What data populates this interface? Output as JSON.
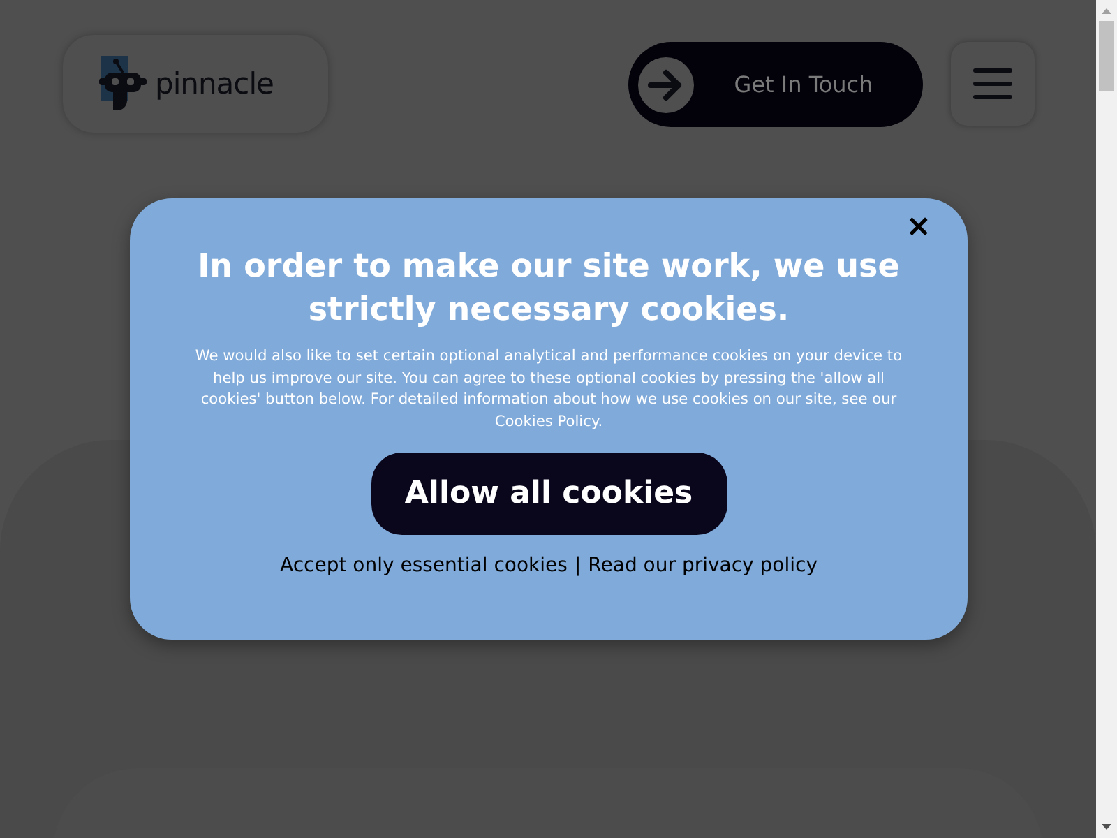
{
  "header": {
    "logo_text": "pinnacle",
    "cta": "Get In Touch"
  },
  "cookie_dialog": {
    "close": "×",
    "title": "In order to make our site work, we use strictly necessary cookies.",
    "body": "We would also like to set certain optional analytical and performance cookies on your device to help us improve our site. You can agree to these optional cookies by pressing the 'allow all cookies' button below. For detailed information about how we use cookies on our site, see our Cookies Policy.",
    "allow_button": "Allow all cookies",
    "links": [
      "Accept only essential cookies",
      "Read our privacy policy"
    ],
    "separator": "|"
  }
}
